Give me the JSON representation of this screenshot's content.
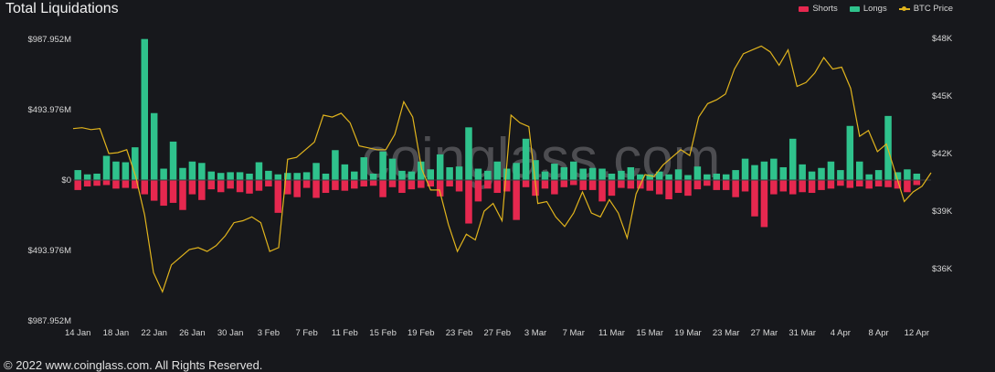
{
  "header": {
    "title": "Total Liquidations"
  },
  "footer": {
    "copyright": "© 2022 www.coinglass.com. All Rights Reserved."
  },
  "watermark": "coinglass.com",
  "colors": {
    "shorts": "#e6284f",
    "longs": "#2fc28c",
    "btc": "#e1b41d"
  },
  "chart_data": {
    "type": "bar",
    "title": "Total Liquidations",
    "legend_position": "top-right",
    "grid": false,
    "legend": [
      "Shorts",
      "Longs",
      "BTC Price"
    ],
    "x_ticks": [
      "14 Jan",
      "18 Jan",
      "22 Jan",
      "26 Jan",
      "30 Jan",
      "3 Feb",
      "7 Feb",
      "11 Feb",
      "15 Feb",
      "19 Feb",
      "23 Feb",
      "27 Feb",
      "3 Mar",
      "7 Mar",
      "11 Mar",
      "15 Mar",
      "19 Mar",
      "23 Mar",
      "27 Mar",
      "31 Mar",
      "4 Apr",
      "8 Apr",
      "12 Apr"
    ],
    "y_left_ticks": [
      "$987.952M",
      "$493.976M",
      "$0",
      "$493.976M",
      "$987.952M"
    ],
    "y_right_ticks": [
      "$48K",
      "$45K",
      "$42K",
      "$39K",
      "$36K"
    ],
    "y_left_range": [
      -987.952,
      987.952
    ],
    "y_right_range": [
      34000,
      48000
    ],
    "dates": [
      "14 Jan",
      "15 Jan",
      "16 Jan",
      "17 Jan",
      "18 Jan",
      "19 Jan",
      "20 Jan",
      "21 Jan",
      "22 Jan",
      "23 Jan",
      "24 Jan",
      "25 Jan",
      "26 Jan",
      "27 Jan",
      "28 Jan",
      "29 Jan",
      "30 Jan",
      "31 Jan",
      "1 Feb",
      "2 Feb",
      "3 Feb",
      "4 Feb",
      "5 Feb",
      "6 Feb",
      "7 Feb",
      "8 Feb",
      "9 Feb",
      "10 Feb",
      "11 Feb",
      "12 Feb",
      "13 Feb",
      "14 Feb",
      "15 Feb",
      "16 Feb",
      "17 Feb",
      "18 Feb",
      "19 Feb",
      "20 Feb",
      "21 Feb",
      "22 Feb",
      "23 Feb",
      "24 Feb",
      "25 Feb",
      "26 Feb",
      "27 Feb",
      "28 Feb",
      "1 Mar",
      "2 Mar",
      "3 Mar",
      "4 Mar",
      "5 Mar",
      "6 Mar",
      "7 Mar",
      "8 Mar",
      "9 Mar",
      "10 Mar",
      "11 Mar",
      "12 Mar",
      "13 Mar",
      "14 Mar",
      "15 Mar",
      "16 Mar",
      "17 Mar",
      "18 Mar",
      "19 Mar",
      "20 Mar",
      "21 Mar",
      "22 Mar",
      "23 Mar",
      "24 Mar",
      "25 Mar",
      "26 Mar",
      "27 Mar",
      "28 Mar",
      "29 Mar",
      "30 Mar",
      "31 Mar",
      "1 Apr",
      "2 Apr",
      "3 Apr",
      "4 Apr",
      "5 Apr",
      "6 Apr",
      "7 Apr",
      "8 Apr",
      "9 Apr",
      "10 Apr",
      "11 Apr",
      "12 Apr",
      "13 Apr"
    ],
    "series": [
      {
        "name": "Longs",
        "unit": "$M",
        "values": [
          70,
          40,
          45,
          170,
          130,
          125,
          230,
          990,
          470,
          80,
          270,
          85,
          130,
          120,
          60,
          50,
          55,
          55,
          45,
          125,
          65,
          40,
          50,
          50,
          55,
          120,
          45,
          210,
          110,
          60,
          160,
          45,
          200,
          150,
          65,
          60,
          130,
          75,
          180,
          90,
          95,
          370,
          80,
          65,
          130,
          80,
          120,
          290,
          140,
          60,
          115,
          90,
          130,
          80,
          85,
          80,
          45,
          65,
          90,
          40,
          40,
          60,
          40,
          75,
          35,
          95,
          40,
          45,
          40,
          70,
          150,
          105,
          130,
          150,
          90,
          290,
          110,
          60,
          85,
          130,
          70,
          380,
          130,
          40,
          70,
          450,
          55,
          75,
          45
        ]
      },
      {
        "name": "Shorts",
        "unit": "$M",
        "values": [
          70,
          45,
          40,
          35,
          60,
          55,
          60,
          100,
          145,
          180,
          160,
          210,
          100,
          140,
          65,
          85,
          60,
          85,
          95,
          75,
          45,
          230,
          100,
          120,
          55,
          125,
          90,
          70,
          75,
          60,
          45,
          40,
          120,
          50,
          90,
          65,
          55,
          45,
          115,
          45,
          80,
          305,
          150,
          60,
          90,
          80,
          280,
          50,
          110,
          60,
          100,
          50,
          35,
          70,
          70,
          150,
          110,
          55,
          60,
          60,
          75,
          100,
          135,
          90,
          110,
          65,
          40,
          70,
          70,
          120,
          80,
          255,
          330,
          100,
          80,
          100,
          85,
          90,
          70,
          60,
          40,
          55,
          45,
          60,
          45,
          50,
          60,
          85,
          35
        ]
      },
      {
        "name": "BTC Price",
        "unit": "$",
        "values": [
          43300,
          43350,
          43250,
          43300,
          42000,
          42050,
          42200,
          40800,
          38800,
          35800,
          34800,
          36200,
          36600,
          37000,
          37100,
          36900,
          37200,
          37700,
          38400,
          38500,
          38700,
          38400,
          36900,
          37100,
          41700,
          41800,
          42200,
          42600,
          44000,
          43900,
          44100,
          43600,
          42400,
          42300,
          42200,
          42200,
          43000,
          44700,
          43900,
          41200,
          40100,
          40100,
          38300,
          36900,
          37800,
          37500,
          39000,
          39400,
          38500,
          44000,
          43600,
          43400,
          39400,
          39500,
          38700,
          38200,
          38900,
          40000,
          38900,
          38700,
          39600,
          38900,
          37600,
          39900,
          40900,
          40800,
          41400,
          41800,
          42200,
          41900,
          43900,
          44600,
          44800,
          45100,
          46400,
          47200,
          47400,
          47600,
          47300,
          46600,
          47400,
          45500,
          45700,
          46200,
          47000,
          46400,
          46500,
          45400,
          42900,
          43200,
          42100,
          42500,
          41000,
          39500,
          40000,
          40300,
          41000
        ]
      }
    ]
  }
}
